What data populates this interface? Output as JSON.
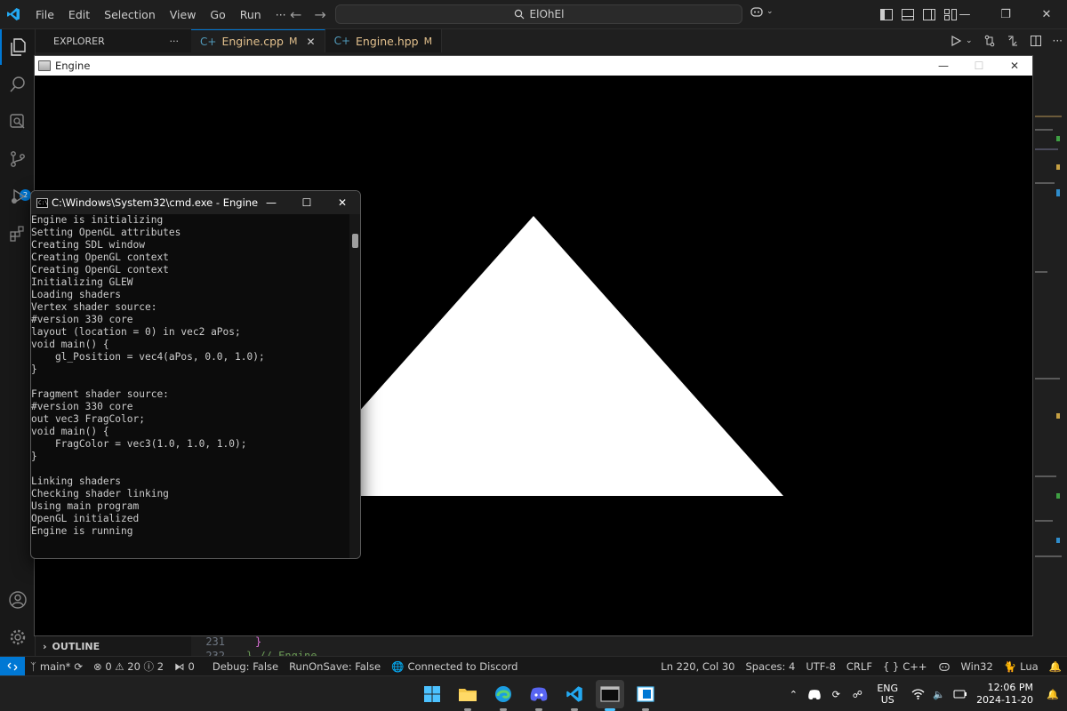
{
  "vscode": {
    "menu": [
      "File",
      "Edit",
      "Selection",
      "View",
      "Go",
      "Run",
      "···"
    ],
    "search_text": "ElOhEl",
    "explorer_label": "EXPLORER",
    "explorer_more": "···",
    "tabs": [
      {
        "glyph": "C+",
        "name": "Engine.cpp",
        "status": "M"
      },
      {
        "glyph": "C+",
        "name": "Engine.hpp",
        "status": "M"
      }
    ],
    "source_control_badge": "2",
    "outline_label": "OUTLINE",
    "code_lines": [
      {
        "num": "231",
        "text": "}"
      },
      {
        "num": "232",
        "text": "} // Engine"
      }
    ]
  },
  "statusbar": {
    "branch": "main*",
    "problems": "⊗ 0 ⚠ 20 ⓘ 2",
    "ports": "0",
    "debug": "Debug: False",
    "run_on_save": "RunOnSave: False",
    "discord": "Connected to Discord",
    "cursor": "Ln 220, Col 30",
    "spaces": "Spaces: 4",
    "encoding": "UTF-8",
    "eol": "CRLF",
    "language": "C++",
    "platform": "Win32",
    "lua": "Lua"
  },
  "engine_window": {
    "title": "Engine"
  },
  "cmd_window": {
    "title": "C:\\Windows\\System32\\cmd.exe - Engine",
    "lines": [
      "Engine is initializing",
      "Setting OpenGL attributes",
      "Creating SDL window",
      "Creating OpenGL context",
      "Creating OpenGL context",
      "Initializing GLEW",
      "Loading shaders",
      "Vertex shader source:",
      "#version 330 core",
      "layout (location = 0) in vec2 aPos;",
      "void main() {",
      "    gl_Position = vec4(aPos, 0.0, 1.0);",
      "}",
      "",
      "Fragment shader source:",
      "#version 330 core",
      "out vec3 FragColor;",
      "void main() {",
      "    FragColor = vec3(1.0, 1.0, 1.0);",
      "}",
      "",
      "Linking shaders",
      "Checking shader linking",
      "Using main program",
      "OpenGL initialized",
      "Engine is running"
    ]
  },
  "taskbar": {
    "apps": [
      "windows-start",
      "file-explorer",
      "edge",
      "discord",
      "vscode",
      "terminal",
      "sdl-app"
    ],
    "active_app": "terminal",
    "lang_top": "ENG",
    "lang_bottom": "US",
    "time": "12:06 PM",
    "date": "2024-11-20"
  },
  "colors": {
    "accent": "#0078d4",
    "modified_tab": "#e2c08d",
    "triangle": "#ffffff"
  }
}
